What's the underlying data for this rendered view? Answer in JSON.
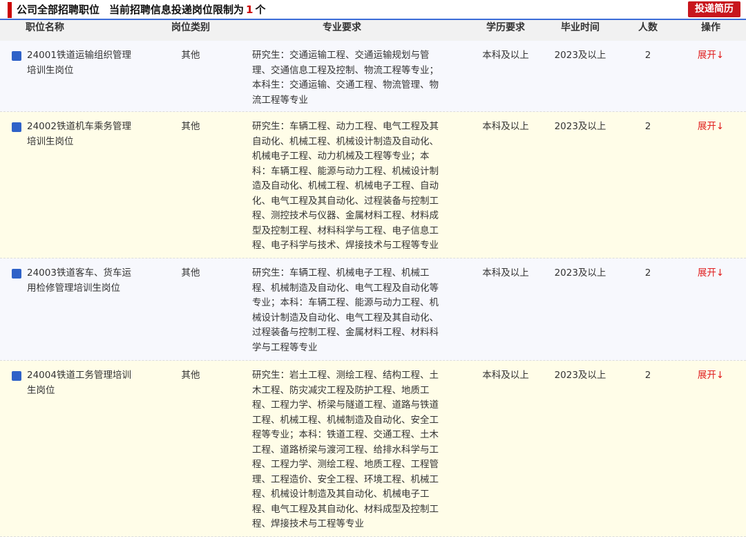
{
  "header": {
    "title": "公司全部招聘职位",
    "limit_label": "当前招聘信息投递岗位限制为",
    "limit_value": "1",
    "limit_unit": "个",
    "apply_button": "投递简历"
  },
  "columns": [
    "职位名称",
    "岗位类别",
    "专业要求",
    "学历要求",
    "毕业时间",
    "人数",
    "操作"
  ],
  "rows": [
    {
      "name_lines": [
        "24001铁道运输组织管理",
        "培训生岗位"
      ],
      "type": "其他",
      "major_lines": [
        "研究生：交通运输工程、交通运输规划与管",
        "理、交通信息工程及控制、物流工程等专业；",
        "本科生：交通运输、交通工程、物流管理、物",
        "流工程等专业"
      ],
      "education": "本科及以上",
      "graduation": "2023及以上",
      "count": "2",
      "action": "展开↓"
    },
    {
      "name_lines": [
        "24002铁道机车乘务管理",
        "培训生岗位"
      ],
      "type": "其他",
      "major_lines": [
        "研究生：车辆工程、动力工程、电气工程及其",
        "自动化、机械工程、机械设计制造及自动化、",
        "机械电子工程、动力机械及工程等专业；本",
        "科：车辆工程、能源与动力工程、机械设计制",
        "造及自动化、机械工程、机械电子工程、自动",
        "化、电气工程及其自动化、过程装备与控制工",
        "程、测控技术与仪器、金属材料工程、材料成",
        "型及控制工程、材料科学与工程、电子信息工",
        "程、电子科学与技术、焊接技术与工程等专业"
      ],
      "education": "本科及以上",
      "graduation": "2023及以上",
      "count": "2",
      "action": "展开↓"
    },
    {
      "name_lines": [
        "24003铁道客车、货车运",
        "用检修管理培训生岗位"
      ],
      "type": "其他",
      "major_lines": [
        "研究生：车辆工程、机械电子工程、机械工",
        "程、机械制造及自动化、电气工程及自动化等",
        "专业；本科：车辆工程、能源与动力工程、机",
        "械设计制造及自动化、电气工程及其自动化、",
        "过程装备与控制工程、金属材料工程、材料科",
        "学与工程等专业"
      ],
      "education": "本科及以上",
      "graduation": "2023及以上",
      "count": "2",
      "action": "展开↓"
    },
    {
      "name_lines": [
        "24004铁道工务管理培训",
        "生岗位"
      ],
      "type": "其他",
      "major_lines": [
        "研究生：岩土工程、测绘工程、结构工程、土",
        "木工程、防灾减灾工程及防护工程、地质工",
        "程、工程力学、桥梁与隧道工程、道路与铁道",
        "工程、机械工程、机械制造及自动化、安全工",
        "程等专业；本科：铁道工程、交通工程、土木",
        "工程、道路桥梁与渡河工程、给排水科学与工",
        "程、工程力学、测绘工程、地质工程、工程管",
        "理、工程造价、安全工程、环境工程、机械工",
        "程、机械设计制造及其自动化、机械电子工",
        "程、电气工程及其自动化、材料成型及控制工",
        "程、焊接技术与工程等专业"
      ],
      "education": "本科及以上",
      "graduation": "2023及以上",
      "count": "2",
      "action": "展开↓"
    }
  ]
}
